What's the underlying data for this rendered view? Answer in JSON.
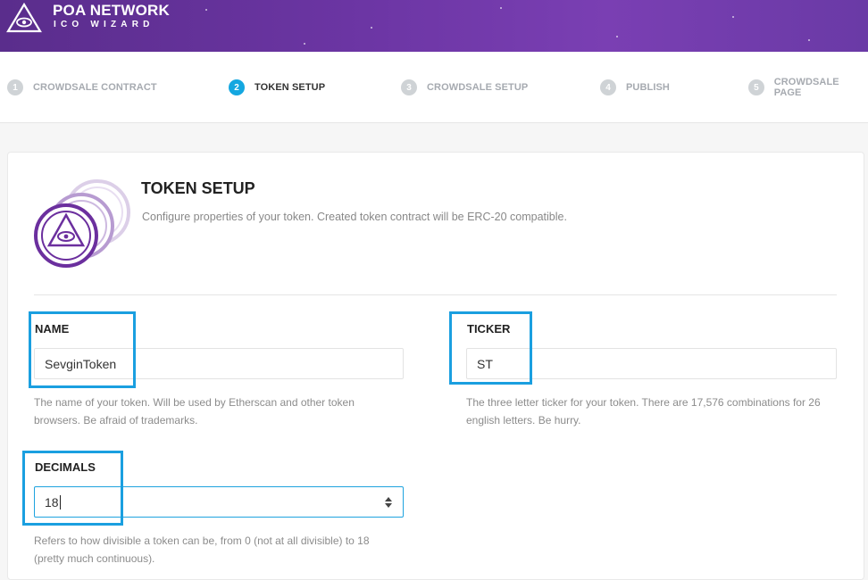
{
  "header": {
    "title": "POA NETWORK",
    "subtitle": "ICO WIZARD"
  },
  "steps": [
    {
      "number": "1",
      "label": "CROWDSALE CONTRACT",
      "active": false
    },
    {
      "number": "2",
      "label": "TOKEN SETUP",
      "active": true
    },
    {
      "number": "3",
      "label": "CROWDSALE SETUP",
      "active": false
    },
    {
      "number": "4",
      "label": "PUBLISH",
      "active": false
    },
    {
      "number": "5",
      "label": "CROWDSALE PAGE",
      "active": false
    }
  ],
  "section": {
    "title": "TOKEN SETUP",
    "description": "Configure properties of your token. Created token contract will be ERC-20 compatible."
  },
  "fields": {
    "name": {
      "label": "NAME",
      "value": "SevginToken",
      "help": "The name of your token. Will be used by Etherscan and other token browsers. Be afraid of trademarks."
    },
    "ticker": {
      "label": "TICKER",
      "value": "ST",
      "help": "The three letter ticker for your token. There are 17,576 combinations for 26 english letters. Be hurry."
    },
    "decimals": {
      "label": "DECIMALS",
      "value": "18",
      "help": "Refers to how divisible a token can be, from 0 (not at all divisible) to 18 (pretty much continuous)."
    }
  },
  "colors": {
    "brand_purple": "#6b35a3",
    "accent_blue": "#14a7e0",
    "highlight_blue": "#1a9fe0"
  }
}
